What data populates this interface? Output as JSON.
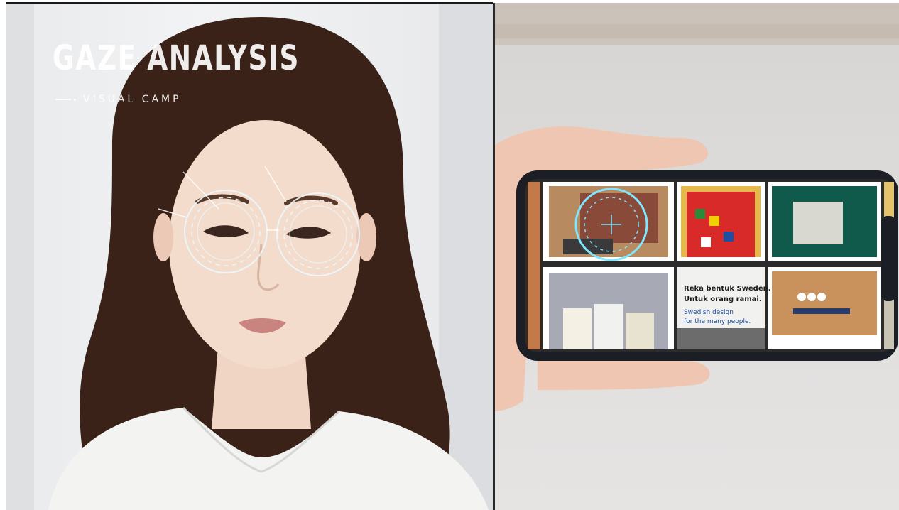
{
  "left_panel": {
    "title": "GAZE ANALYSIS",
    "brand": "VISUAL CAMP"
  },
  "right_panel": {
    "ad": {
      "line1": "Reka bentuk Sweden.",
      "line2": "Untuk orang ramai.",
      "line3": "Swedish design",
      "line4": "for the many people."
    }
  },
  "colors": {
    "gaze_ring": "#7fe6ff",
    "hair": "#3a2218",
    "phone_frame": "#1b1e24"
  }
}
